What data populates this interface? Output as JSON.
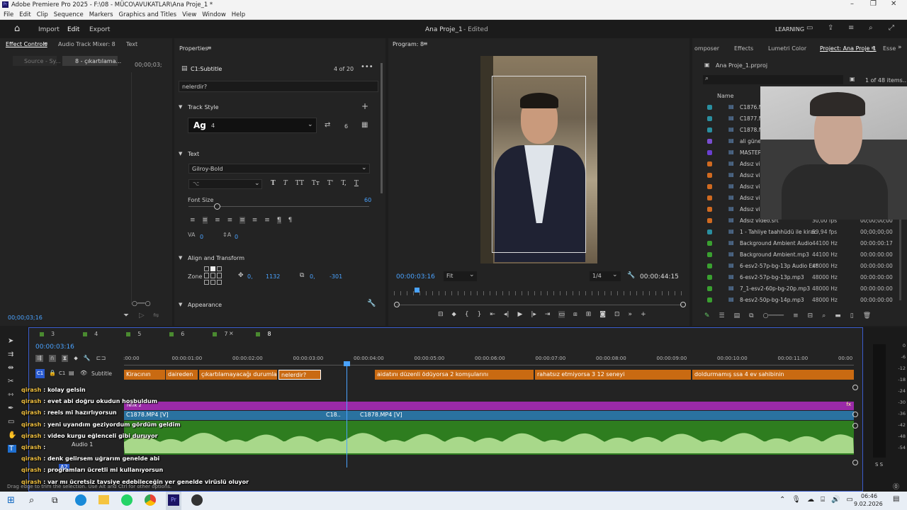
{
  "window": {
    "title": "Adobe Premiere Pro 2025 - F:\\08 - MÜCO\\AVUKATLAR\\Ana Proje_1 *"
  },
  "menu": [
    "File",
    "Edit",
    "Clip",
    "Sequence",
    "Markers",
    "Graphics and Titles",
    "View",
    "Window",
    "Help"
  ],
  "header": {
    "home": "home-icon",
    "import": "Import",
    "edit": "Edit",
    "export": "Export",
    "project_title": "Ana Proje_1",
    "status": "- Edited",
    "learning": "LEARNING"
  },
  "effect_controls": {
    "tabs": [
      "Effect Controls",
      "Audio Track Mixer: 8",
      "Text"
    ],
    "source": "Source - Sy...",
    "seq": "8 - çıkartılama...",
    "time": "00;00;03;",
    "timecode": "00;00;03;16"
  },
  "properties": {
    "title": "Properties",
    "clip": "C1:Subtitle",
    "count": "4 of 20",
    "caption_text": "nelerdir?",
    "track_style": "Track Style",
    "style_name": "Ag",
    "style_value": "4",
    "style_num": "6",
    "text_section": "Text",
    "font": "Gilroy-Bold",
    "font_size_label": "Font Size",
    "font_size_value": "60",
    "tracking": "0",
    "leading": "0",
    "align_transform": "Align and Transform",
    "zone": "Zone",
    "pos_x": "0,",
    "pos_y": "1132",
    "anchor_x": "0,",
    "anchor_y": "-301",
    "appearance": "Appearance"
  },
  "program": {
    "title": "Program: 8",
    "timecode": "00:00:03:16",
    "fit": "Fit",
    "resolution": "1/4",
    "duration": "00:00:44:15"
  },
  "project": {
    "tabs": [
      "omposer",
      "Effects",
      "Lumetri Color",
      "Project: Ana Proje_1",
      "Esse"
    ],
    "file": "Ana Proje_1.prproj",
    "count": "1 of 48 items...",
    "name_header": "Name",
    "items": [
      {
        "name": "C1876.M",
        "fps": "",
        "dur": "",
        "color": "#2a8fa0"
      },
      {
        "name": "C1877.M",
        "fps": "",
        "dur": "",
        "color": "#2a8fa0"
      },
      {
        "name": "C1878.M",
        "fps": "",
        "dur": "",
        "color": "#2a8fa0"
      },
      {
        "name": "ali güney",
        "fps": "",
        "dur": "",
        "color": "#7a4fd0"
      },
      {
        "name": "MASTER",
        "fps": "",
        "dur": "",
        "color": "#6a3fd0"
      },
      {
        "name": "Adsız vid",
        "fps": "",
        "dur": "",
        "color": "#d06a20"
      },
      {
        "name": "Adsız vid",
        "fps": "",
        "dur": "",
        "color": "#d06a20"
      },
      {
        "name": "Adsız vid",
        "fps": "",
        "dur": "",
        "color": "#d06a20"
      },
      {
        "name": "Adsız vid",
        "fps": "",
        "dur": "",
        "color": "#d06a20"
      },
      {
        "name": "Adsız vid",
        "fps": "",
        "dur": "",
        "color": "#d06a20"
      },
      {
        "name": "Adsız video.srt",
        "fps": "30,00 fps",
        "dur": "00;00;00;00",
        "color": "#d06a20"
      },
      {
        "name": "1 - Tahliye taahhüdü ile kirac",
        "fps": "59,94 fps",
        "dur": "00;00;00;00",
        "color": "#2a8fa0"
      },
      {
        "name": "Background Ambient Audio",
        "fps": "44100 Hz",
        "dur": "00:00:00:17",
        "color": "#3aa030"
      },
      {
        "name": "Background Ambient.mp3",
        "fps": "44100 Hz",
        "dur": "00:00:00:00",
        "color": "#3aa030"
      },
      {
        "name": "6-esv2-57p-bg-13p Audio Ext",
        "fps": "48000 Hz",
        "dur": "00:00:00:00",
        "color": "#3aa030"
      },
      {
        "name": "6-esv2-57p-bg-13p.mp3",
        "fps": "48000 Hz",
        "dur": "00:00:00:00",
        "color": "#3aa030"
      },
      {
        "name": "7_1-esv2-60p-bg-20p.mp3",
        "fps": "48000 Hz",
        "dur": "00:00:00:00",
        "color": "#3aa030"
      },
      {
        "name": "8-esv2-50p-bg-14p.mp3",
        "fps": "48000 Hz",
        "dur": "00:00:00:00",
        "color": "#3aa030"
      }
    ]
  },
  "timeline": {
    "tabs": [
      "3",
      "4",
      "5",
      "6",
      "7",
      "8"
    ],
    "timecode": "00:00:03:16",
    "ruler": [
      ":00:00",
      "00:00:01:00",
      "00:00:02:00",
      "00:00:03:00",
      "00:00:04:00",
      "00:00:05:00",
      "00:00:06:00",
      "00:00:07:00",
      "00:00:08:00",
      "00:00:09:00",
      "00:00:10:00",
      "00:00:11:00",
      "00:00"
    ],
    "subtitle_track": "Subtitle",
    "c1": "C1",
    "captions": [
      "Kiracının",
      "daireden",
      "çıkartılamayacağı durumlar",
      "nelerdir?",
      "aidatını düzenli ödüyorsa 2 komşularını",
      "rahatsız etmiyorsa 3 12 seneyi",
      "doldurmamış ssa 4 ev sahibinin"
    ],
    "v2_label": "renk 2",
    "v1_clips": [
      "C1878.MP4 [V]",
      "C18..",
      "C1878.MP4 [V]"
    ],
    "audio_label": "Audio 1",
    "a2": "A2",
    "meter": [
      "0",
      "-6",
      "-12",
      "-18",
      "-24",
      "-30",
      "-36",
      "-42",
      "-48",
      "-54"
    ],
    "meter_foot": "S  S"
  },
  "status_bar": "Drag edge to trim the selection. Use Alt and Ctrl for other options.",
  "chat": [
    {
      "user": "qirash",
      "msg": ": kolay gelsin"
    },
    {
      "user": "qirash",
      "msg": ": evet abi doğru okudun hoşbuldum"
    },
    {
      "user": "qirash",
      "msg": ": reels mi hazırlıyorsun"
    },
    {
      "user": "qirash",
      "msg": ": yeni uyandım geziyordum gördüm geldim"
    },
    {
      "user": "qirash",
      "msg": ": video kurgu eğlenceli gibi duruyor"
    },
    {
      "user": "qirash",
      "msg": ":"
    },
    {
      "user": "qirash",
      "msg": ": denk gelirsem uğrarım genelde abi"
    },
    {
      "user": "qirash",
      "msg": ": programları ücretli mi kullanıyorsun"
    },
    {
      "user": "qirash",
      "msg": ": var mı ücretsiz tavsiye edebileceğin yer genelde virüslü oluyor"
    }
  ],
  "taskbar": {
    "time": "06:46",
    "date": "9.02.2026"
  }
}
